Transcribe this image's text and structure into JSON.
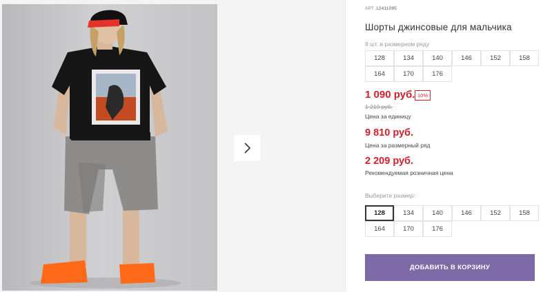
{
  "product": {
    "article_label": "АРТ",
    "article_value": "12411095",
    "title": "Шорты джинсовые для мальчика",
    "row_note": "9 шт. в размерном ряду",
    "row_sizes": [
      "128",
      "134",
      "140",
      "146",
      "152",
      "158",
      "164",
      "170",
      "176"
    ]
  },
  "pricing": {
    "unit_price": "1 090 руб.",
    "discount": "10%",
    "old_price": "1 210 руб.",
    "unit_caption": "Цена за единицу",
    "row_price": "9 810 руб.",
    "row_caption": "Цена за размерный ряд",
    "retail_price": "2 209 руб.",
    "retail_caption": "Рекомендуемая розничная цена"
  },
  "size_select": {
    "label": "Выберите размер:",
    "sizes": [
      "128",
      "134",
      "140",
      "146",
      "152",
      "158",
      "164",
      "170",
      "176"
    ],
    "selected": "128"
  },
  "actions": {
    "add_to_cart": "ДОБАВИТЬ В КОРЗИНУ",
    "next_arrow": "›"
  },
  "colors": {
    "accent_red": "#d0202e",
    "button_purple": "#7d69a6"
  },
  "icons": {
    "next": "chevron-right-icon"
  }
}
